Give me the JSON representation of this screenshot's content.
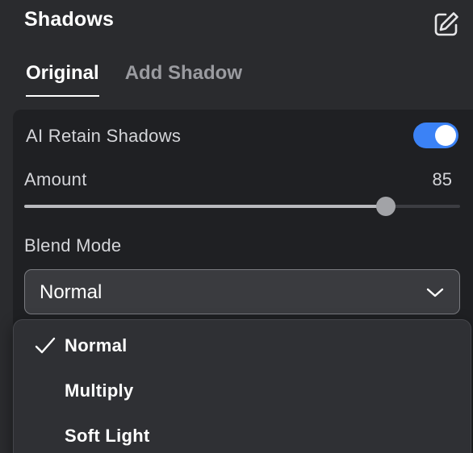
{
  "panel": {
    "title": "Shadows",
    "edit_icon": "edit-pencil-icon"
  },
  "tabs": [
    {
      "label": "Original",
      "active": true
    },
    {
      "label": "Add Shadow",
      "active": false
    }
  ],
  "retain_shadows": {
    "label": "AI Retain Shadows",
    "enabled": true,
    "accent_color": "#3b82f6"
  },
  "amount": {
    "label": "Amount",
    "value": "85",
    "level_fraction": 0.83
  },
  "blend_mode": {
    "label": "Blend Mode",
    "selected": "Normal",
    "chevron_icon": "chevron-down-icon",
    "options": [
      {
        "label": "Normal",
        "checked": true
      },
      {
        "label": "Multiply",
        "checked": false
      },
      {
        "label": "Soft Light",
        "checked": false
      }
    ]
  }
}
